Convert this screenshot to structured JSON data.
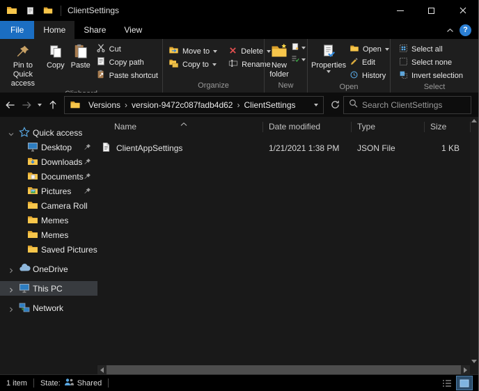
{
  "window": {
    "title": "ClientSettings"
  },
  "colors": {
    "accent_blue": "#1b6ec2",
    "folder_yellow": "#f7c64b",
    "selection_gray": "#383b3f",
    "delete_red": "#e04f4f"
  },
  "ribbon": {
    "tabs": {
      "file": "File",
      "home": "Home",
      "share": "Share",
      "view": "View"
    },
    "help": "?",
    "groups": {
      "clipboard": {
        "label": "Clipboard",
        "pin_to_quick_access": "Pin to Quick access",
        "copy": "Copy",
        "paste": "Paste",
        "cut": "Cut",
        "copy_path": "Copy path",
        "paste_shortcut": "Paste shortcut"
      },
      "organize": {
        "label": "Organize",
        "move_to": "Move to",
        "copy_to": "Copy to",
        "delete": "Delete",
        "rename": "Rename"
      },
      "new": {
        "label": "New",
        "new_folder": "New folder"
      },
      "open": {
        "label": "Open",
        "properties": "Properties",
        "open": "Open",
        "edit": "Edit",
        "history": "History"
      },
      "select": {
        "label": "Select",
        "select_all": "Select all",
        "select_none": "Select none",
        "invert_selection": "Invert selection"
      }
    }
  },
  "navigation": {
    "breadcrumb": [
      "Versions",
      "version-9472c087fadb4d62",
      "ClientSettings"
    ],
    "search_placeholder": "Search ClientSettings"
  },
  "sidebar": {
    "items": [
      {
        "label": "Quick access"
      },
      {
        "label": "Desktop"
      },
      {
        "label": "Downloads"
      },
      {
        "label": "Documents"
      },
      {
        "label": "Pictures"
      },
      {
        "label": "Camera Roll"
      },
      {
        "label": "Memes"
      },
      {
        "label": "Memes"
      },
      {
        "label": "Saved Pictures"
      },
      {
        "label": "OneDrive"
      },
      {
        "label": "This PC"
      },
      {
        "label": "Network"
      }
    ]
  },
  "file_list": {
    "columns": {
      "name": "Name",
      "date_modified": "Date modified",
      "type": "Type",
      "size": "Size"
    },
    "rows": [
      {
        "name": "ClientAppSettings",
        "date_modified": "1/21/2021 1:38 PM",
        "type": "JSON File",
        "size": "1 KB"
      }
    ]
  },
  "status_bar": {
    "item_count": "1 item",
    "state_label": "State:",
    "state_value": "Shared"
  }
}
